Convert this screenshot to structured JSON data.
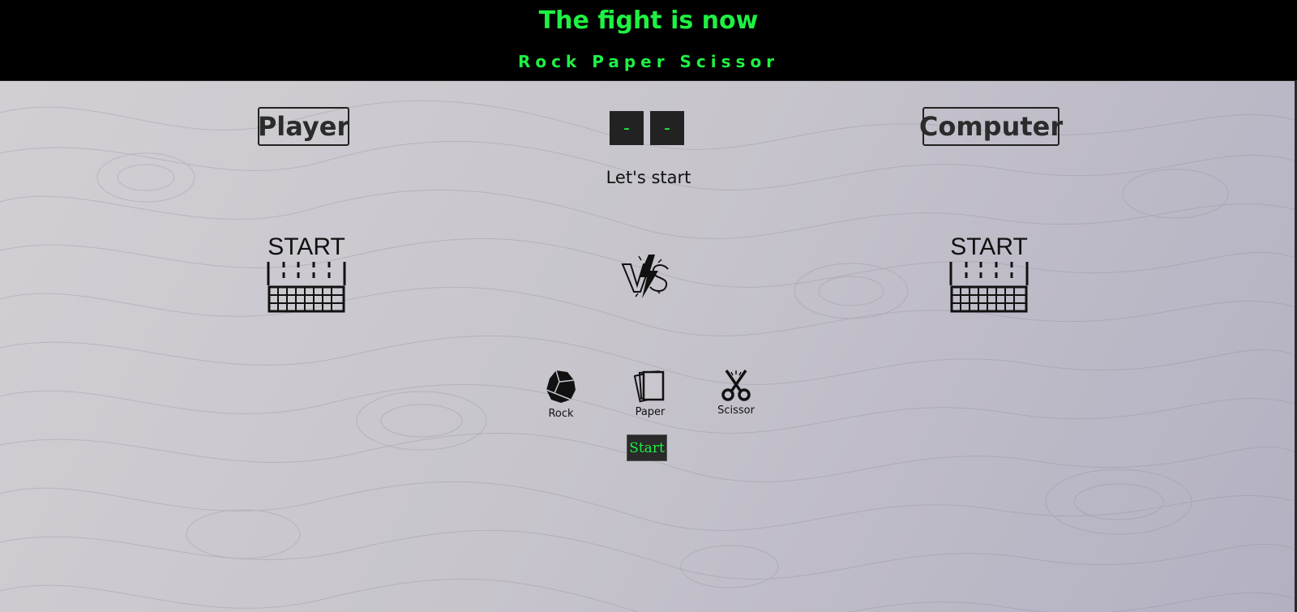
{
  "header": {
    "title": "The fight is now",
    "subtitle": "Rock Paper Scissor"
  },
  "players": {
    "player_label": "Player",
    "computer_label": "Computer"
  },
  "score": {
    "player": "-",
    "computer": "-"
  },
  "status_text": "Let's start",
  "start_image_text": "START",
  "choices": [
    {
      "label": "Rock",
      "icon": "rock-icon"
    },
    {
      "label": "Paper",
      "icon": "paper-icon"
    },
    {
      "label": "Scissor",
      "icon": "scissor-icon"
    }
  ],
  "start_button": "Start",
  "colors": {
    "accent": "#1ef143",
    "header_bg": "#000000",
    "dark_box": "#222222"
  }
}
